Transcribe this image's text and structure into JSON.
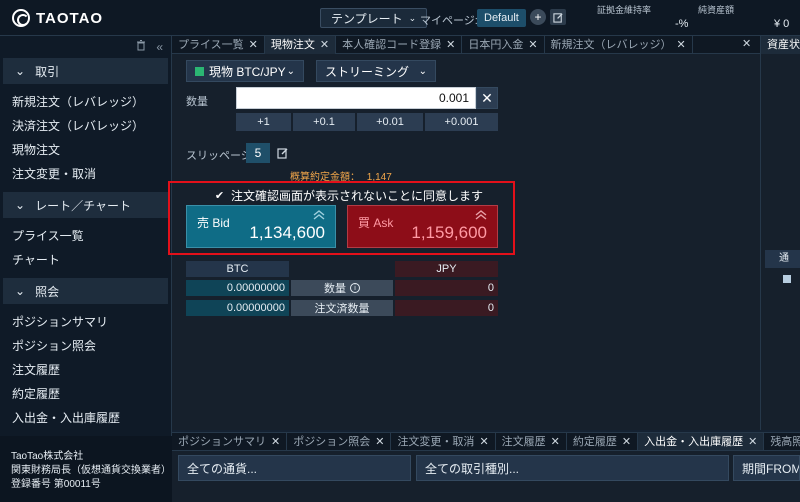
{
  "header": {
    "logo_text": "TAOTAO",
    "template_label": "テンプレート",
    "mypage_label": "マイページ:",
    "default_badge": "Default",
    "margin_rate_label": "証拠金維持率",
    "margin_rate_value": "-%",
    "net_assets_label": "純資産額",
    "net_assets_value": "¥ 0"
  },
  "sidebar": {
    "sections": [
      {
        "title": "取引",
        "items": [
          "新規注文（レバレッジ）",
          "決済注文（レバレッジ）",
          "現物注文",
          "注文変更・取消"
        ]
      },
      {
        "title": "レート／チャート",
        "items": [
          "プライス一覧",
          "チャート"
        ]
      },
      {
        "title": "照会",
        "items": [
          "ポジションサマリ",
          "ポジション照会",
          "注文履歴",
          "約定履歴",
          "入出金・入出庫履歴"
        ]
      }
    ],
    "footer": [
      "TaoTao株式会社",
      "関東財務局長（仮想通貨交換業者）",
      "登録番号 第00011号"
    ]
  },
  "tabs": [
    {
      "label": "プライス一覧",
      "active": false
    },
    {
      "label": "現物注文",
      "active": true
    },
    {
      "label": "本人確認コード登録",
      "active": false
    },
    {
      "label": "日本円入金",
      "active": false
    },
    {
      "label": "新規注文（レバレッジ）",
      "active": false
    }
  ],
  "right_panel_tab": "資産状",
  "right_panel_row": "通",
  "order": {
    "pair": "現物 BTC/JPY",
    "mode": "ストリーミング",
    "qty_label": "数量",
    "qty_value": "0.001",
    "increments": [
      "+1",
      "+0.1",
      "+0.01",
      "+0.001"
    ],
    "slippage_label": "スリッページ",
    "slippage_value": "5",
    "estimate_label": "概算約定金額：",
    "estimate_value": "1,147",
    "agree_text": "注文確認画面が表示されないことに同意します",
    "agree_checked": true,
    "bid_label": "売 Bid",
    "bid_price": "1,134,600",
    "ask_label": "買 Ask",
    "ask_price": "1,159,600"
  },
  "balance": {
    "btc_header": "BTC",
    "jpy_header": "JPY",
    "rows": [
      {
        "label": "数量",
        "btc": "0.00000000",
        "jpy": "0"
      },
      {
        "label": "注文済数量",
        "btc": "0.00000000",
        "jpy": "0"
      }
    ]
  },
  "bottom_tabs": [
    {
      "label": "ポジションサマリ",
      "active": false
    },
    {
      "label": "ポジション照会",
      "active": false
    },
    {
      "label": "注文変更・取消",
      "active": false
    },
    {
      "label": "注文履歴",
      "active": false
    },
    {
      "label": "約定履歴",
      "active": false
    },
    {
      "label": "入出金・入出庫履歴",
      "active": true
    },
    {
      "label": "残高照会",
      "active": false
    }
  ],
  "filters": {
    "currency": "全ての通貨...",
    "trade_type": "全ての取引種別...",
    "period": "期間FROM"
  },
  "colors": {
    "bid": "#0f6c86",
    "ask": "#8d0d18",
    "highlight": "#e3101a",
    "estimate": "#f0a54a"
  }
}
